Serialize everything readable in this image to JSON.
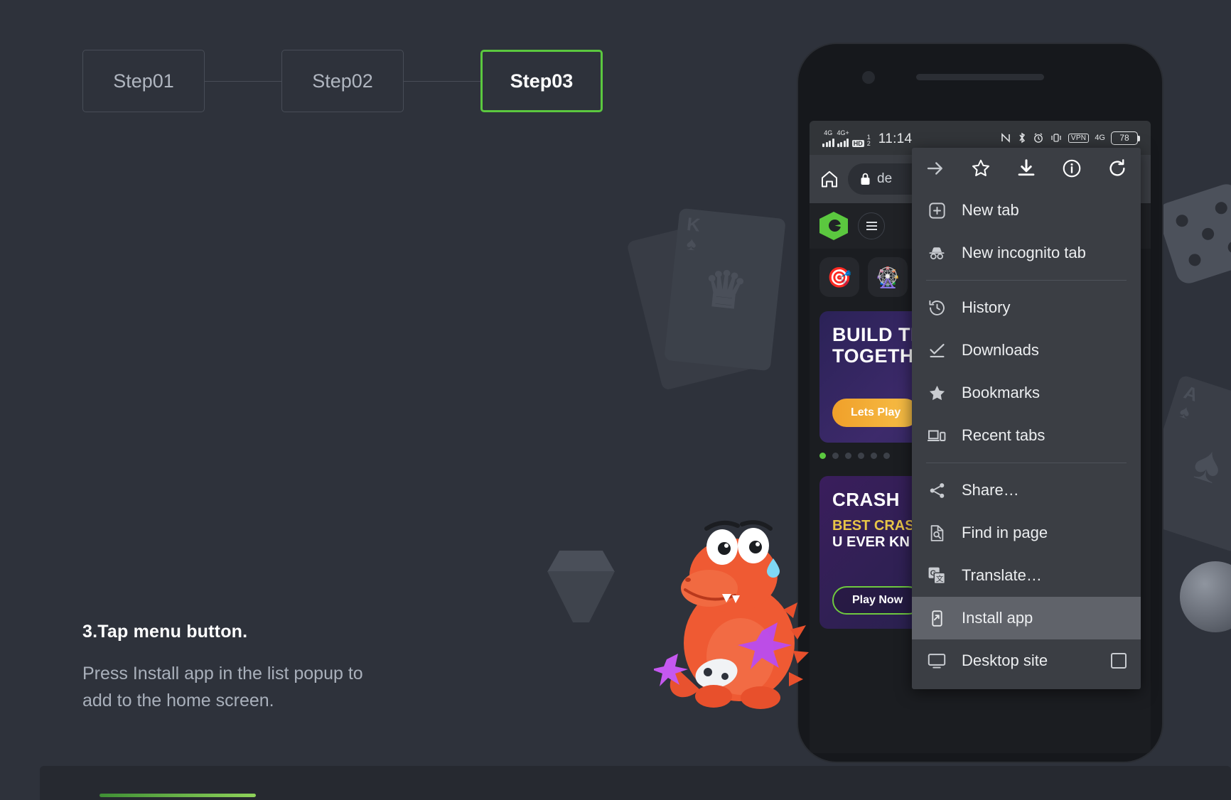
{
  "steps": [
    {
      "label": "Step01",
      "active": false
    },
    {
      "label": "Step02",
      "active": false
    },
    {
      "label": "Step03",
      "active": true
    }
  ],
  "instructions": {
    "title": "3.Tap menu button.",
    "body_line1": "Press Install app in the list popup to",
    "body_line2": "add to the home screen."
  },
  "colors": {
    "accent_green": "#5bc83f",
    "page_bg": "#2e323b",
    "menu_bg": "#3b3e44",
    "menu_highlight": "#60636a",
    "text_muted": "#a9b0bb"
  },
  "phone": {
    "statusbar": {
      "network_1": "4G",
      "network_2": "4G+",
      "hd_badge": "HD",
      "sim_slot": "1",
      "sim_slot2": "2",
      "time": "11:14",
      "vpn_badge": "VPN",
      "network_right": "4G",
      "battery_percent": "78"
    },
    "browser": {
      "home_icon": "home-icon",
      "lock_icon": "lock-icon",
      "url_text": "de"
    },
    "site": {
      "logo": "brand-logo",
      "menu_icon": "hamburger-icon",
      "tiles": [
        {
          "name": "target-tile",
          "glyph": "🎯"
        },
        {
          "name": "wheel-tile",
          "glyph": "🎡"
        }
      ],
      "banner1": {
        "title_line1": "BUILD TI",
        "title_line2": "TOGETH",
        "button": "Lets Play"
      },
      "carousel_dots": 6,
      "carousel_active": 0,
      "banner2": {
        "title": "CRASH",
        "sub1": "BEST CRAS",
        "sub2": "U EVER KN",
        "button": "Play Now"
      }
    }
  },
  "menu": {
    "toolbar": [
      {
        "name": "forward-icon",
        "label": "Forward"
      },
      {
        "name": "bookmark-star-icon",
        "label": "Bookmark"
      },
      {
        "name": "download-icon",
        "label": "Download"
      },
      {
        "name": "page-info-icon",
        "label": "Page info"
      },
      {
        "name": "reload-icon",
        "label": "Reload"
      }
    ],
    "items": [
      {
        "label": "New tab",
        "icon": "new-tab-icon",
        "highlight": false,
        "checkbox": false
      },
      {
        "label": "New incognito tab",
        "icon": "incognito-icon",
        "highlight": false,
        "checkbox": false
      },
      {
        "label": "History",
        "icon": "history-icon",
        "highlight": false,
        "checkbox": false
      },
      {
        "label": "Downloads",
        "icon": "downloads-check-icon",
        "highlight": false,
        "checkbox": false
      },
      {
        "label": "Bookmarks",
        "icon": "bookmarks-star-icon",
        "highlight": false,
        "checkbox": false
      },
      {
        "label": "Recent tabs",
        "icon": "recent-tabs-icon",
        "highlight": false,
        "checkbox": false
      },
      {
        "label": "Share…",
        "icon": "share-icon",
        "highlight": false,
        "checkbox": false
      },
      {
        "label": "Find in page",
        "icon": "find-in-page-icon",
        "highlight": false,
        "checkbox": false
      },
      {
        "label": "Translate…",
        "icon": "translate-icon",
        "highlight": false,
        "checkbox": false
      },
      {
        "label": "Install app",
        "icon": "install-app-icon",
        "highlight": true,
        "checkbox": false
      },
      {
        "label": "Desktop site",
        "icon": "desktop-site-icon",
        "highlight": false,
        "checkbox": true
      }
    ],
    "separators_after": [
      1,
      5
    ]
  }
}
